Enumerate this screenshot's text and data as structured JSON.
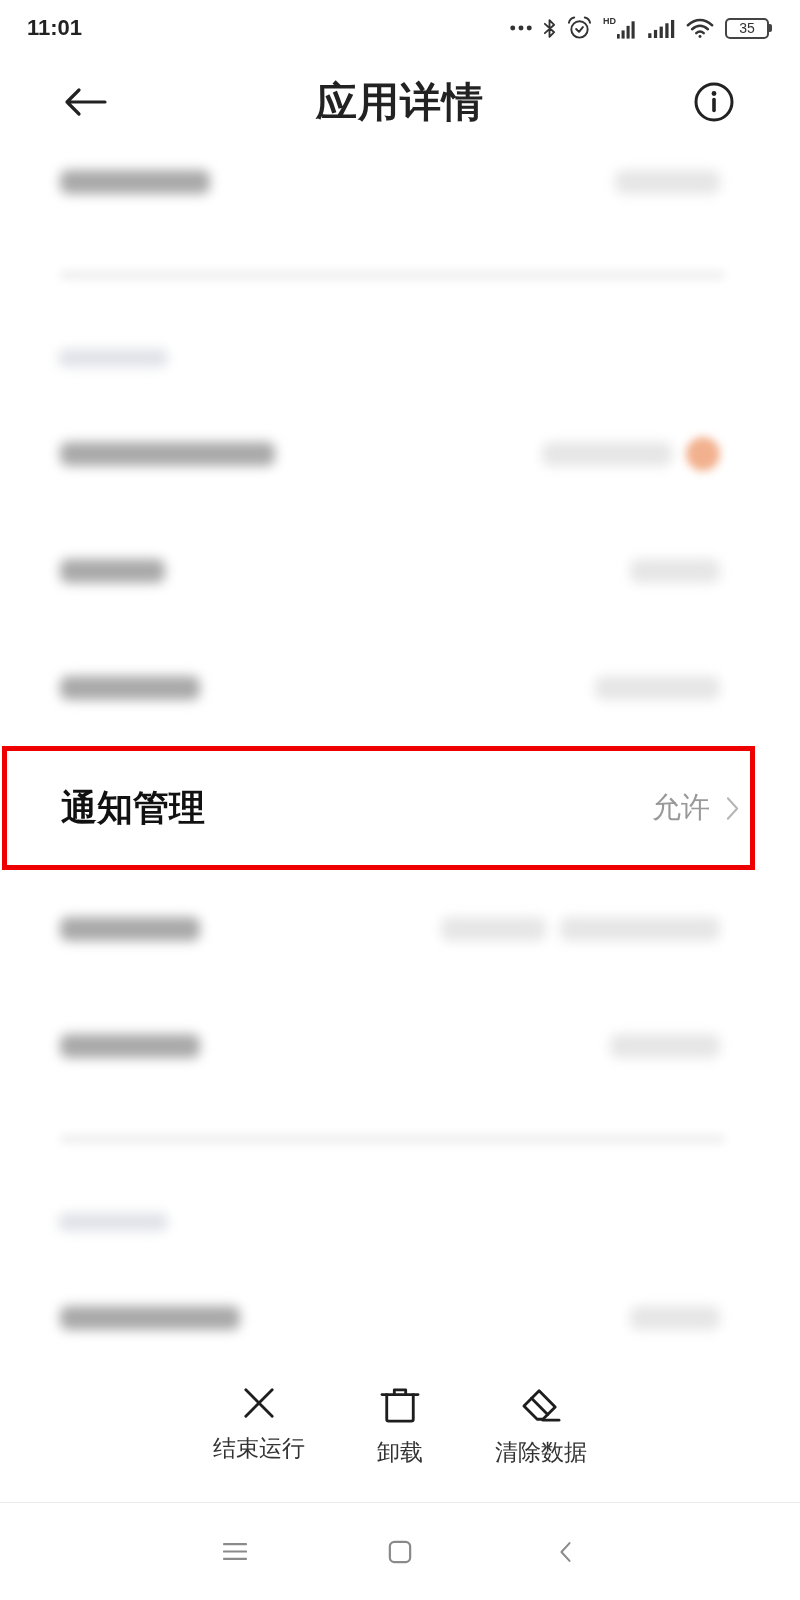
{
  "status_bar": {
    "time": "11:01",
    "network_label": "HD",
    "battery": "35"
  },
  "header": {
    "title": "应用详情"
  },
  "settings_list": [
    {
      "kind": "obscured",
      "badge": false
    },
    {
      "kind": "divider"
    },
    {
      "kind": "heading"
    },
    {
      "kind": "obscured",
      "badge": true
    },
    {
      "kind": "obscured",
      "badge": false
    },
    {
      "kind": "obscured",
      "badge": false
    },
    {
      "kind": "entry",
      "label": "通知管理",
      "value": "允许",
      "highlighted": true
    },
    {
      "kind": "obscured",
      "badge": false
    },
    {
      "kind": "obscured",
      "badge": false
    },
    {
      "kind": "divider"
    },
    {
      "kind": "heading"
    },
    {
      "kind": "obscured",
      "badge": false
    }
  ],
  "actions": [
    {
      "kind": "stop",
      "label": "结束运行"
    },
    {
      "kind": "uninstall",
      "label": "卸载"
    },
    {
      "kind": "clear",
      "label": "清除数据"
    }
  ]
}
